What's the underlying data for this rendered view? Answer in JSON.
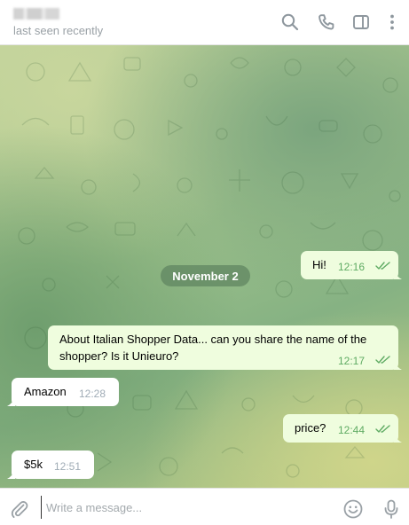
{
  "header": {
    "status": "last seen recently",
    "icons": [
      "search-icon",
      "phone-icon",
      "sidebar-toggle-icon",
      "more-vertical-icon"
    ]
  },
  "chat": {
    "date_separator": "November 2",
    "messages": [
      {
        "direction": "out",
        "text": "Hi!",
        "time": "12:16",
        "read": true
      },
      {
        "direction": "out",
        "text_line1": "About Italian Shopper Data... can you share the name of the",
        "text_line2": "shopper? Is it Unieuro?",
        "time": "12:17",
        "read": true
      },
      {
        "direction": "in",
        "text": "Amazon",
        "time": "12:28"
      },
      {
        "direction": "out",
        "text": "price?",
        "time": "12:44",
        "read": true
      },
      {
        "direction": "in",
        "text": "$5k",
        "time": "12:51"
      }
    ]
  },
  "composer": {
    "placeholder": "Write a message...",
    "icons": [
      "paperclip-icon",
      "emoji-icon",
      "microphone-icon"
    ]
  },
  "colors": {
    "outgoing_bubble": "#effdde",
    "incoming_bubble": "#ffffff",
    "outgoing_time": "#5fab63",
    "incoming_time": "#a0acb6",
    "date_pill": "#5e845f"
  }
}
